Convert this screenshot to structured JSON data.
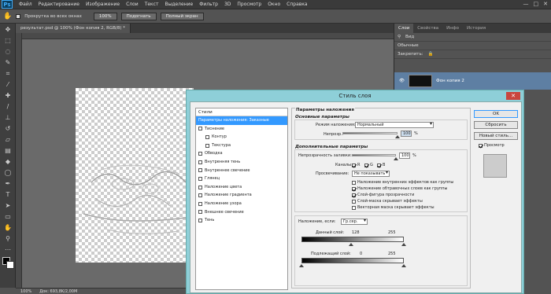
{
  "menubar": {
    "logo": "Ps",
    "items": [
      "Файл",
      "Редактирование",
      "Изображение",
      "Слои",
      "Текст",
      "Выделение",
      "Фильтр",
      "3D",
      "Просмотр",
      "Окно",
      "Справка"
    ],
    "win_buttons": [
      "—",
      "□",
      "✕"
    ]
  },
  "optbar": {
    "scroll_all_label": "Прокрутка во всех окнах",
    "zoom_100": "100%",
    "fit_label": "Подогнать",
    "fullscreen_label": "Полный экран"
  },
  "document": {
    "tab_title": "результат.psd @ 100% (Фон копия 2, RGB/8) *",
    "status_zoom": "100%",
    "status_doc": "Док: 693,8K/2,00M"
  },
  "rpanel": {
    "tabs": [
      "Слои",
      "Свойства",
      "Инфо",
      "История"
    ],
    "kind_label": "Вид",
    "blend_mode": "Обычные",
    "lock_label": "Закрепить:",
    "layer_name": "Фон копия 2"
  },
  "dialog": {
    "title": "Стиль слоя",
    "styles_header": "Стили",
    "styles": [
      {
        "label": "Параметры наложения: Заказные",
        "selected": true,
        "indent": false,
        "checkbox": false
      },
      {
        "label": "Тиснение",
        "selected": false,
        "indent": false,
        "checkbox": true
      },
      {
        "label": "Контур",
        "selected": false,
        "indent": true,
        "checkbox": true
      },
      {
        "label": "Текстура",
        "selected": false,
        "indent": true,
        "checkbox": true
      },
      {
        "label": "Обводка",
        "selected": false,
        "indent": false,
        "checkbox": true
      },
      {
        "label": "Внутренняя тень",
        "selected": false,
        "indent": false,
        "checkbox": true
      },
      {
        "label": "Внутреннее свечение",
        "selected": false,
        "indent": false,
        "checkbox": true
      },
      {
        "label": "Глянец",
        "selected": false,
        "indent": false,
        "checkbox": true
      },
      {
        "label": "Наложение цвета",
        "selected": false,
        "indent": false,
        "checkbox": true
      },
      {
        "label": "Наложение градиента",
        "selected": false,
        "indent": false,
        "checkbox": true
      },
      {
        "label": "Наложение узора",
        "selected": false,
        "indent": false,
        "checkbox": true
      },
      {
        "label": "Внешнее свечение",
        "selected": false,
        "indent": false,
        "checkbox": true
      },
      {
        "label": "Тень",
        "selected": false,
        "indent": false,
        "checkbox": true
      }
    ],
    "blending_title": "Параметры наложения",
    "general_title": "Основные параметры",
    "blend_mode_label": "Режим наложения:",
    "blend_mode_value": "Нормальный",
    "opacity_label": "Непрозр.:",
    "opacity_value": "100",
    "percent": "%",
    "advanced_title": "Дополнительные параметры",
    "fill_opacity_label": "Непрозрачность заливки:",
    "fill_opacity_value": "100",
    "channels_label": "Каналы:",
    "channels": [
      "R",
      "G",
      "B"
    ],
    "knockout_label": "Просвечивание:",
    "knockout_value": "Не показывать",
    "options": [
      {
        "label": "Наложение внутренних эффектов как группы",
        "checked": false
      },
      {
        "label": "Наложение обтравочных слоев как группы",
        "checked": true
      },
      {
        "label": "Слой-фигура прозрачности",
        "checked": true
      },
      {
        "label": "Слой-маска скрывает эффекты",
        "checked": false
      },
      {
        "label": "Векторная маска скрывает эффекты",
        "checked": false
      }
    ],
    "blend_if_label": "Наложение, если:",
    "blend_if_value": "Гр.сер.",
    "this_layer_label": "Данный слой:",
    "this_layer_min": "128",
    "this_layer_max": "255",
    "underlying_label": "Подлежащий слой:",
    "underlying_min": "0",
    "underlying_max": "255",
    "buttons": {
      "ok": "OK",
      "reset": "Сбросить",
      "new_style": "Новый стиль...",
      "preview": "Просмотр"
    }
  }
}
